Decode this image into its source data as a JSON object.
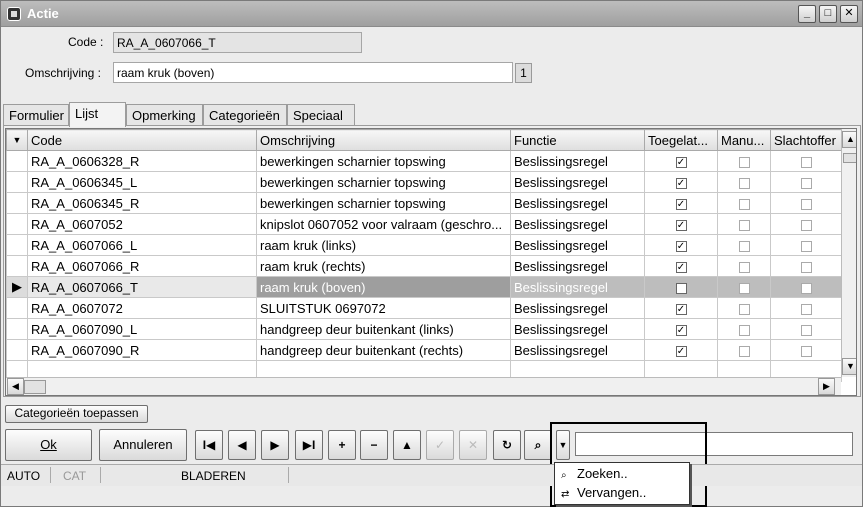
{
  "window": {
    "title": "Actie"
  },
  "header": {
    "code_label": "Code :",
    "code_value": "RA_A_0607066_T",
    "omschrijving_label": "Omschrijving :",
    "omschrijving_value": "raam kruk (boven)",
    "counter": "1"
  },
  "tabs": [
    "Formulier",
    "Lijst",
    "Opmerking",
    "Categorieën",
    "Speciaal"
  ],
  "active_tab": "Lijst",
  "grid": {
    "columns": [
      "Code",
      "Omschrijving",
      "Functie",
      "Toegelat...",
      "Manu...",
      "Slachtoffer"
    ],
    "rows": [
      {
        "code": "RA_A_0606328_R",
        "omschrijving": "bewerkingen scharnier topswing",
        "functie": "Beslissingsregel",
        "toegelaten": true,
        "manu": false,
        "slachtoffer": false
      },
      {
        "code": "RA_A_0606345_L",
        "omschrijving": "bewerkingen scharnier topswing",
        "functie": "Beslissingsregel",
        "toegelaten": true,
        "manu": false,
        "slachtoffer": false
      },
      {
        "code": "RA_A_0606345_R",
        "omschrijving": "bewerkingen scharnier topswing",
        "functie": "Beslissingsregel",
        "toegelaten": true,
        "manu": false,
        "slachtoffer": false
      },
      {
        "code": "RA_A_0607052",
        "omschrijving": "knipslot 0607052 voor valraam (geschro...",
        "functie": "Beslissingsregel",
        "toegelaten": true,
        "manu": false,
        "slachtoffer": false
      },
      {
        "code": "RA_A_0607066_L",
        "omschrijving": "raam kruk (links)",
        "functie": "Beslissingsregel",
        "toegelaten": true,
        "manu": false,
        "slachtoffer": false
      },
      {
        "code": "RA_A_0607066_R",
        "omschrijving": "raam kruk (rechts)",
        "functie": "Beslissingsregel",
        "toegelaten": true,
        "manu": false,
        "slachtoffer": false
      },
      {
        "code": "RA_A_0607066_T",
        "omschrijving": "raam kruk (boven)",
        "functie": "Beslissingsregel",
        "toegelaten": true,
        "manu": false,
        "slachtoffer": false,
        "selected": true
      },
      {
        "code": "RA_A_0607072",
        "omschrijving": "SLUITSTUK 0697072",
        "functie": "Beslissingsregel",
        "toegelaten": true,
        "manu": false,
        "slachtoffer": false
      },
      {
        "code": "RA_A_0607090_L",
        "omschrijving": "handgreep deur buitenkant (links)",
        "functie": "Beslissingsregel",
        "toegelaten": true,
        "manu": false,
        "slachtoffer": false
      },
      {
        "code": "RA_A_0607090_R",
        "omschrijving": "handgreep deur buitenkant (rechts)",
        "functie": "Beslissingsregel",
        "toegelaten": true,
        "manu": false,
        "slachtoffer": false
      }
    ]
  },
  "buttons": {
    "categorieen": "Categorieën toepassen",
    "ok": "Ok",
    "annuleren": "Annuleren"
  },
  "navigation": [
    {
      "name": "first-record",
      "glyph": "I◀"
    },
    {
      "name": "prev-record",
      "glyph": "◀"
    },
    {
      "name": "next-record",
      "glyph": "▶"
    },
    {
      "name": "last-record",
      "glyph": "▶I"
    },
    {
      "name": "add-record",
      "glyph": "+"
    },
    {
      "name": "delete-record",
      "glyph": "−"
    },
    {
      "name": "edit-record",
      "glyph": "▲"
    },
    {
      "name": "post-record",
      "glyph": "✓"
    },
    {
      "name": "cancel-record",
      "glyph": "✕"
    },
    {
      "name": "refresh",
      "glyph": "↻"
    },
    {
      "name": "find",
      "glyph": "⌕"
    }
  ],
  "dropdown": {
    "zoeken": "Zoeken..",
    "vervangen": "Vervangen.."
  },
  "statusbar": {
    "mode": "AUTO",
    "cat": "CAT",
    "state": "BLADEREN"
  }
}
